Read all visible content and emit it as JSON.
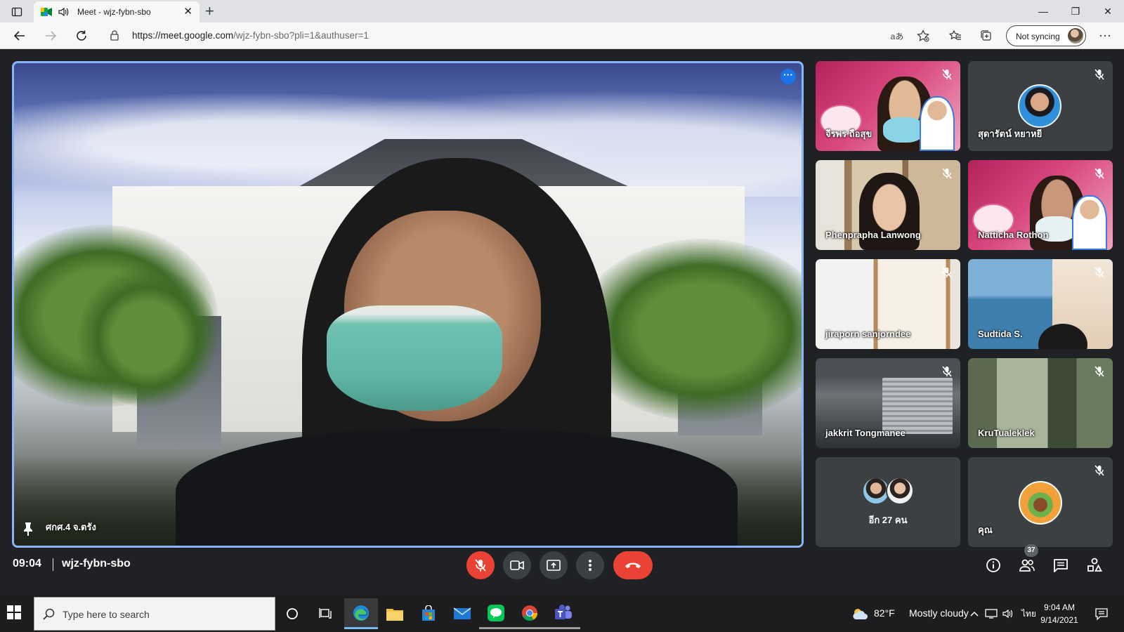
{
  "browser": {
    "tab_title": "Meet - wjz-fybn-sbo",
    "tab_close": "✕",
    "new_tab": "+",
    "url_host": "https://meet.google.com",
    "url_path": "/wjz-fybn-sbo?pli=1&authuser=1",
    "sync_label": "Not syncing",
    "window_controls": {
      "minimize": "—",
      "restore": "❐",
      "close": "✕"
    },
    "reader_label": "aあ"
  },
  "meet": {
    "main_participant": "ศกศ.4 จ.ตรัง",
    "tiles": [
      {
        "name": "จีรพร ถือสุข",
        "muted": true,
        "kind": "banner"
      },
      {
        "name": "สุดารัตน์ หยาหยี",
        "muted": true,
        "kind": "avatar"
      },
      {
        "name": "Phenprapha Lanwong",
        "muted": true,
        "kind": "bookshelf"
      },
      {
        "name": "Natticha Rothon",
        "muted": true,
        "kind": "banner"
      },
      {
        "name": "jiraporn sanjorndee",
        "muted": true,
        "kind": "shelf"
      },
      {
        "name": "Sudtida S.",
        "muted": true,
        "kind": "sea"
      },
      {
        "name": "jakkrit Tongmanee",
        "muted": true,
        "kind": "room"
      },
      {
        "name": "KruTualeklek",
        "muted": true,
        "kind": "forest"
      },
      {
        "name": "อีก 27 คน",
        "muted": false,
        "kind": "more"
      },
      {
        "name": "คุณ",
        "muted": true,
        "kind": "self"
      }
    ],
    "clock": "09:04",
    "meeting_code": "wjz-fybn-sbo",
    "people_count": "37",
    "colors": {
      "accent": "#8ab4f8",
      "danger": "#ea4335",
      "surface": "#202124",
      "tile": "#3c4043"
    }
  },
  "taskbar": {
    "search_placeholder": "Type here to search",
    "weather_temp": "82°F",
    "weather_text": "Mostly cloudy",
    "language": "ไทย",
    "time": "9:04 AM",
    "date": "9/14/2021"
  }
}
